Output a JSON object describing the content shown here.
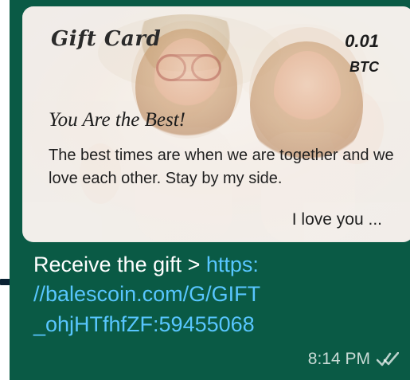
{
  "card": {
    "header": "Gift Card",
    "amount": "0.01",
    "unit": "BTC",
    "title": "You Are the Best!",
    "body": "The best times are when we are together and we love each other. Stay by my side.",
    "sign": "I love you ..."
  },
  "message": {
    "prefix": "Receive the gift > ",
    "link_line1": "https:",
    "link_line2": "//balescoin.com/G/GIFT",
    "link_line3": "_ohjHTfhfZF:59455068"
  },
  "meta": {
    "time": "8:14 PM"
  },
  "colors": {
    "bubble": "#0a5a45",
    "link": "#58c6ff",
    "card_bg": "#f6f3f0"
  },
  "icons": {
    "status": "double-check-icon"
  }
}
